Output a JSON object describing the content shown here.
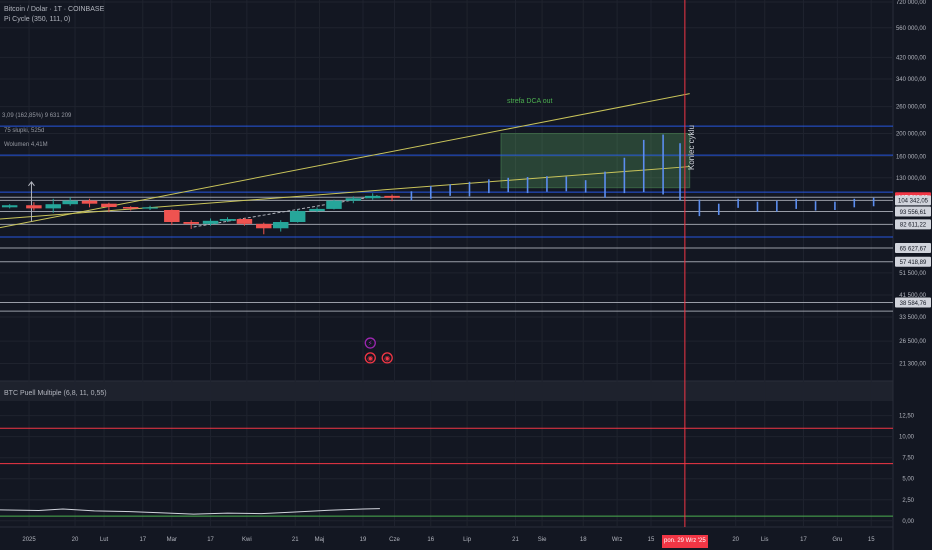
{
  "chart_data": [
    {
      "type": "candlestick",
      "title": "Bitcoin / Dolar · 1T · COINBASE",
      "indicator_label": "Pi Cycle (350, 111, 0)",
      "y_axis": {
        "scale": "log",
        "range": [
          18500,
          720000
        ],
        "tick_labels": [
          "720 000,00",
          "560 000,00",
          "420 000,00",
          "340 000,00",
          "260 000,00",
          "200 000,00",
          "160 000,00",
          "130 000,00",
          "51 500,00",
          "41 500,00",
          "33 500,00",
          "26 500,00",
          "21 300,00"
        ],
        "tick_values": [
          720000,
          560000,
          420000,
          340000,
          260000,
          200000,
          160000,
          130000,
          51500,
          41500,
          33500,
          26500,
          21300
        ]
      },
      "x_axis": {
        "tick_labels": [
          "2025",
          "20",
          "Lut",
          "17",
          "Mar",
          "17",
          "Kwi",
          "21",
          "Maj",
          "19",
          "Cze",
          "16",
          "Lip",
          "21",
          "Sie",
          "18",
          "Wrz",
          "15",
          "20",
          "Lis",
          "17",
          "Gru",
          "15"
        ],
        "tick_dates": [
          "2025-01-01",
          "2025-01-20",
          "2025-02-01",
          "2025-02-17",
          "2025-03-01",
          "2025-03-17",
          "2025-04-01",
          "2025-04-21",
          "2025-05-01",
          "2025-05-19",
          "2025-06-01",
          "2025-06-16",
          "2025-07-01",
          "2025-07-21",
          "2025-08-01",
          "2025-08-18",
          "2025-09-01",
          "2025-09-15",
          "2025-10-20",
          "2025-11-01",
          "2025-11-17",
          "2025-12-01",
          "2025-12-15"
        ],
        "range": [
          "2024-12-20",
          "2025-12-24"
        ],
        "cursor_label": "pon. 29 Wrz '25",
        "cursor_date": "2025-09-29"
      },
      "candles": [
        {
          "date": "2024-12-24",
          "open": 97500,
          "close": 99500,
          "high": 100500,
          "low": 96500
        },
        {
          "date": "2025-01-03",
          "open": 99500,
          "close": 96500,
          "high": 102500,
          "low": 94500
        },
        {
          "date": "2025-01-11",
          "open": 96500,
          "close": 100500,
          "high": 106000,
          "low": 92500
        },
        {
          "date": "2025-01-18",
          "open": 100500,
          "close": 104000,
          "high": 107500,
          "low": 99000
        },
        {
          "date": "2025-01-26",
          "open": 104000,
          "close": 101000,
          "high": 106000,
          "low": 97500
        },
        {
          "date": "2025-02-03",
          "open": 101000,
          "close": 97800,
          "high": 102000,
          "low": 93000
        },
        {
          "date": "2025-02-12",
          "open": 97800,
          "close": 96300,
          "high": 98500,
          "low": 94500
        },
        {
          "date": "2025-02-20",
          "open": 96300,
          "close": 97500,
          "high": 99000,
          "low": 95000
        },
        {
          "date": "2025-03-01",
          "open": 95000,
          "close": 84500,
          "high": 95500,
          "low": 82000
        },
        {
          "date": "2025-03-09",
          "open": 84500,
          "close": 83000,
          "high": 86000,
          "low": 79000
        },
        {
          "date": "2025-03-17",
          "open": 83000,
          "close": 85500,
          "high": 87500,
          "low": 81500
        },
        {
          "date": "2025-03-24",
          "open": 85500,
          "close": 87000,
          "high": 88500,
          "low": 84500
        },
        {
          "date": "2025-03-31",
          "open": 87000,
          "close": 83000,
          "high": 88000,
          "low": 81500
        },
        {
          "date": "2025-04-08",
          "open": 83000,
          "close": 79500,
          "high": 84000,
          "low": 75000
        },
        {
          "date": "2025-04-15",
          "open": 79500,
          "close": 84500,
          "high": 86000,
          "low": 77000
        },
        {
          "date": "2025-04-22",
          "open": 84500,
          "close": 94000,
          "high": 95500,
          "low": 84000
        },
        {
          "date": "2025-04-30",
          "open": 94000,
          "close": 96000,
          "high": 97500,
          "low": 93000
        },
        {
          "date": "2025-05-07",
          "open": 96000,
          "close": 104000,
          "high": 105000,
          "low": 95500
        },
        {
          "date": "2025-05-15",
          "open": 104000,
          "close": 106500,
          "high": 108500,
          "low": 101500
        },
        {
          "date": "2025-05-23",
          "open": 106500,
          "close": 109000,
          "high": 111800,
          "low": 105000
        },
        {
          "date": "2025-05-31",
          "open": 109000,
          "close": 107000,
          "high": 110500,
          "low": 103500
        }
      ],
      "projection_bars": [
        {
          "date": "2025-06-08",
          "high": 114000,
          "low": 104500
        },
        {
          "date": "2025-06-16",
          "high": 120000,
          "low": 106000
        },
        {
          "date": "2025-06-24",
          "high": 122000,
          "low": 109000
        },
        {
          "date": "2025-07-02",
          "high": 125000,
          "low": 108500
        },
        {
          "date": "2025-07-10",
          "high": 128000,
          "low": 112000
        },
        {
          "date": "2025-07-18",
          "high": 130000,
          "low": 113000
        },
        {
          "date": "2025-07-26",
          "high": 131000,
          "low": 112000
        },
        {
          "date": "2025-08-03",
          "high": 132000,
          "low": 113500
        },
        {
          "date": "2025-08-11",
          "high": 131500,
          "low": 114000
        },
        {
          "date": "2025-08-19",
          "high": 127000,
          "low": 112500
        },
        {
          "date": "2025-08-27",
          "high": 138000,
          "low": 107000
        },
        {
          "date": "2025-09-04",
          "high": 158000,
          "low": 112000
        },
        {
          "date": "2025-09-12",
          "high": 188000,
          "low": 113000
        },
        {
          "date": "2025-09-20",
          "high": 198000,
          "low": 110500
        },
        {
          "date": "2025-09-27",
          "high": 182000,
          "low": 104500
        },
        {
          "date": "2025-10-05",
          "high": 105000,
          "low": 89500
        },
        {
          "date": "2025-10-13",
          "high": 101000,
          "low": 90500
        },
        {
          "date": "2025-10-21",
          "high": 106000,
          "low": 97000
        },
        {
          "date": "2025-10-29",
          "high": 103000,
          "low": 93500
        },
        {
          "date": "2025-11-06",
          "high": 104000,
          "low": 93500
        },
        {
          "date": "2025-11-14",
          "high": 106000,
          "low": 96000
        },
        {
          "date": "2025-11-22",
          "high": 103500,
          "low": 94500
        },
        {
          "date": "2025-11-30",
          "high": 103000,
          "low": 95000
        },
        {
          "date": "2025-12-08",
          "high": 106000,
          "low": 97500
        },
        {
          "date": "2025-12-16",
          "high": 107000,
          "low": 98500
        }
      ],
      "horizontal_lines": [
        {
          "value": 215000,
          "color": "#2962ff"
        },
        {
          "value": 162000,
          "color": "#2962ff"
        },
        {
          "value": 113000,
          "color": "#2962ff"
        },
        {
          "value": 107582.29,
          "color": "#b2b5be"
        },
        {
          "value": 104342.05,
          "color": "#b2b5be"
        },
        {
          "value": 93556.61,
          "color": "#b2b5be"
        },
        {
          "value": 82611.22,
          "color": "#b2b5be"
        },
        {
          "value": 73000,
          "color": "#2962ff"
        },
        {
          "value": 65627.67,
          "color": "#b2b5be"
        },
        {
          "value": 57418.89,
          "color": "#b2b5be"
        },
        {
          "value": 38584.76,
          "color": "#b2b5be"
        },
        {
          "value": 35500,
          "color": "#b2b5be"
        }
      ],
      "price_labels": [
        {
          "value": 107582.29,
          "text": "107 582,29",
          "highlight": true
        },
        {
          "value": 104342.05,
          "text": "104 342,05",
          "highlight": false
        },
        {
          "value": 93556.61,
          "text": "93 556,61",
          "highlight": false
        },
        {
          "value": 82611.22,
          "text": "82 611,22",
          "highlight": false
        },
        {
          "value": 65627.67,
          "text": "65 627,67",
          "highlight": false
        },
        {
          "value": 57418.89,
          "text": "57 418,89",
          "highlight": false
        },
        {
          "value": 38584.76,
          "text": "38 584,76",
          "highlight": false
        }
      ],
      "trend_lines": [
        {
          "from": {
            "date": "2024-12-20",
            "value": 80000
          },
          "to": {
            "date": "2025-10-01",
            "value": 295000
          },
          "color": "#c9c45a"
        },
        {
          "from": {
            "date": "2024-12-20",
            "value": 87000
          },
          "to": {
            "date": "2025-10-01",
            "value": 145000
          },
          "color": "#c9c45a"
        },
        {
          "from": {
            "date": "2025-03-10",
            "value": 80500
          },
          "to": {
            "date": "2025-05-25",
            "value": 109000
          },
          "color": "#b2b5be"
        }
      ],
      "zone": {
        "from": "2025-07-15",
        "to": "2025-10-01",
        "low": 118000,
        "high": 200000,
        "color": "#66bb6a",
        "label": "strefa DCA out"
      },
      "measure": {
        "date": "2025-01-02",
        "from": 85000,
        "to": 125000,
        "lines": [
          "3,09 (162,85%) 9 631 209",
          "75 słupki, 525d",
          "Wolumen 4,41M"
        ]
      },
      "cursor_annotation": "Koniec cyklu",
      "event_badges": [
        {
          "date": "2025-05-22",
          "value": 26000,
          "glyph": "⚡",
          "color": "#9c27b0"
        },
        {
          "date": "2025-05-22",
          "value": 22500,
          "glyph": "◉",
          "color": "#f23645"
        },
        {
          "date": "2025-05-29",
          "value": 22500,
          "glyph": "◉",
          "color": "#f23645"
        }
      ]
    },
    {
      "type": "line",
      "title": "BTC Puell Multiple (6,8, 11, 0,55)",
      "y_axis": {
        "range": [
          -0.5,
          14
        ],
        "tick_labels": [
          "12,50",
          "10,00",
          "7,50",
          "5,00",
          "2,50",
          "0,00"
        ],
        "tick_values": [
          12.5,
          10,
          7.5,
          5,
          2.5,
          0
        ]
      },
      "levels": [
        {
          "value": 11,
          "color": "#f23645"
        },
        {
          "value": 6.8,
          "color": "#f23645"
        },
        {
          "value": 0.55,
          "color": "#4caf50"
        }
      ],
      "series": [
        {
          "x": [
            "2024-12-20",
            "2025-01-05",
            "2025-01-15",
            "2025-01-28",
            "2025-02-10",
            "2025-02-24",
            "2025-03-10",
            "2025-03-24",
            "2025-04-07",
            "2025-04-21",
            "2025-05-05",
            "2025-05-19",
            "2025-05-26"
          ],
          "y": [
            1.3,
            1.22,
            1.4,
            1.18,
            1.1,
            0.95,
            0.8,
            0.92,
            0.85,
            1.05,
            1.25,
            1.4,
            1.45
          ],
          "color": "#d1d4dc"
        }
      ]
    }
  ]
}
